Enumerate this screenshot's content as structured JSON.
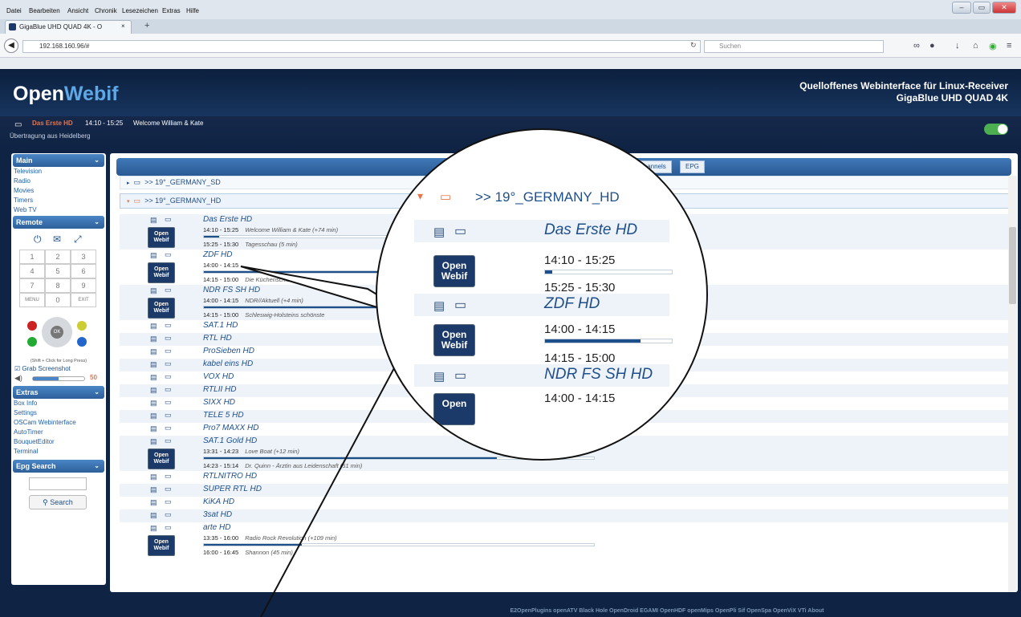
{
  "menubar": [
    "Datei",
    "Bearbeiten",
    "Ansicht",
    "Chronik",
    "Lesezeichen",
    "Extras",
    "Hilfe"
  ],
  "browser": {
    "tab_title": "GigaBlue UHD QUAD 4K - O",
    "url": "192.168.160.96/#",
    "search_placeholder": "Suchen"
  },
  "header": {
    "logo_open": "Open",
    "logo_webif": "Webif",
    "tagline": "Quelloffenes Webinterface für Linux-Receiver",
    "device": "GigaBlue UHD QUAD 4K"
  },
  "now_playing": {
    "channel": "Das Erste HD",
    "time": "14:10 - 15:25",
    "title": "Welcome William & Kate",
    "subtitle": "Übertragung aus Heidelberg"
  },
  "sidebar": {
    "main_title": "Main",
    "main_items": [
      "Television",
      "Radio",
      "Movies",
      "Timers",
      "Web TV"
    ],
    "remote_title": "Remote",
    "keypad": [
      "1",
      "2",
      "3",
      "4",
      "5",
      "6",
      "7",
      "8",
      "9",
      "MENU",
      "0",
      "EXIT"
    ],
    "ok": "OK",
    "hint": "(Shift + Click for Long Press)",
    "grab": "Grab Screenshot",
    "volume": "50",
    "extras_title": "Extras",
    "extras_items": [
      "Box Info",
      "Settings",
      "OSCam Webinterface",
      "AutoTimer",
      "BouquetEditor",
      "Terminal"
    ],
    "epg_title": "Epg Search",
    "search_button": "Search"
  },
  "tabs": [
    "Channels",
    "EPG"
  ],
  "bouquets": [
    ">> 19°_GERMANY_SD",
    ">> 19°_GERMANY_HD"
  ],
  "channels": [
    {
      "name": "Das Erste HD",
      "now": "14:10 - 15:25",
      "now_title": "Welcome William & Kate (+74 min)",
      "next": "15:25 - 15:30",
      "next_title": "Tagesschau (5 min)",
      "progress": 0.04
    },
    {
      "name": "ZDF HD",
      "now": "14:00 - 14:15",
      "now_title": "",
      "next": "14:15 - 15:00",
      "next_title": "Die Küchenschlacht",
      "progress": 0.75
    },
    {
      "name": "NDR FS SH HD",
      "now": "14:00 - 14:15",
      "now_title": "NDR//Aktuell (+4 min)",
      "next": "14:15 - 15:00",
      "next_title": "Schleswig-Holsteins schönste",
      "progress": 0.72
    },
    {
      "name": "SAT.1 HD"
    },
    {
      "name": "RTL HD"
    },
    {
      "name": "ProSieben HD"
    },
    {
      "name": "kabel eins HD"
    },
    {
      "name": "VOX HD"
    },
    {
      "name": "RTLII HD"
    },
    {
      "name": "SIXX HD"
    },
    {
      "name": "TELE 5 HD"
    },
    {
      "name": "Pro7 MAXX HD"
    },
    {
      "name": "SAT.1 Gold HD",
      "now": "13:31 - 14:23",
      "now_title": "Love Boat (+12 min)",
      "next": "14:23 - 15:14",
      "next_title": "Dr. Quinn - Ärztin aus Leidenschaft (51 min)",
      "progress": 0.75
    },
    {
      "name": "RTLNITRO HD"
    },
    {
      "name": "SUPER RTL HD"
    },
    {
      "name": "KiKA HD"
    },
    {
      "name": "3sat HD"
    },
    {
      "name": "arte HD",
      "now": "13:35 - 16:00",
      "now_title": "Radio Rock Revolution (+109 min)",
      "next": "16:00 - 16:45",
      "next_title": "Shannon (45 min)",
      "progress": 0.25
    }
  ],
  "magnifier": {
    "bouquet": ">> 19°_GERMANY_HD",
    "ch1": "Das Erste HD",
    "ch1_now": "14:10 - 15:25",
    "ch1_next": "15:25 - 15:30",
    "ch2": "ZDF HD",
    "ch2_now": "14:00 - 14:15",
    "ch2_next": "14:15 - 15:00",
    "ch3": "NDR FS SH HD",
    "ch3_now": "14:00 - 14:15",
    "logo_line1": "Open",
    "logo_line2": "Webif"
  },
  "footer": "E2OpenPlugins   openATV   Black Hole   OpenDroid   EGAMI   OpenHDF   openMips   OpenPli   Sif   OpenSpa   OpenViX   VTi   About"
}
